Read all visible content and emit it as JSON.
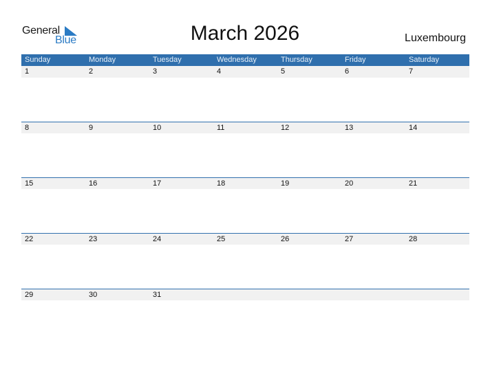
{
  "logo": {
    "word1": "General",
    "word2": "Blue",
    "icon": "triangle-flag-icon"
  },
  "title": "March 2026",
  "country": "Luxembourg",
  "colors": {
    "header_bg": "#2f6fad",
    "logo_blue": "#2b7bc4",
    "date_band": "#f1f1f1"
  },
  "weekdays": [
    "Sunday",
    "Monday",
    "Tuesday",
    "Wednesday",
    "Thursday",
    "Friday",
    "Saturday"
  ],
  "weeks": [
    [
      "1",
      "2",
      "3",
      "4",
      "5",
      "6",
      "7"
    ],
    [
      "8",
      "9",
      "10",
      "11",
      "12",
      "13",
      "14"
    ],
    [
      "15",
      "16",
      "17",
      "18",
      "19",
      "20",
      "21"
    ],
    [
      "22",
      "23",
      "24",
      "25",
      "26",
      "27",
      "28"
    ],
    [
      "29",
      "30",
      "31",
      "",
      "",
      "",
      ""
    ]
  ]
}
